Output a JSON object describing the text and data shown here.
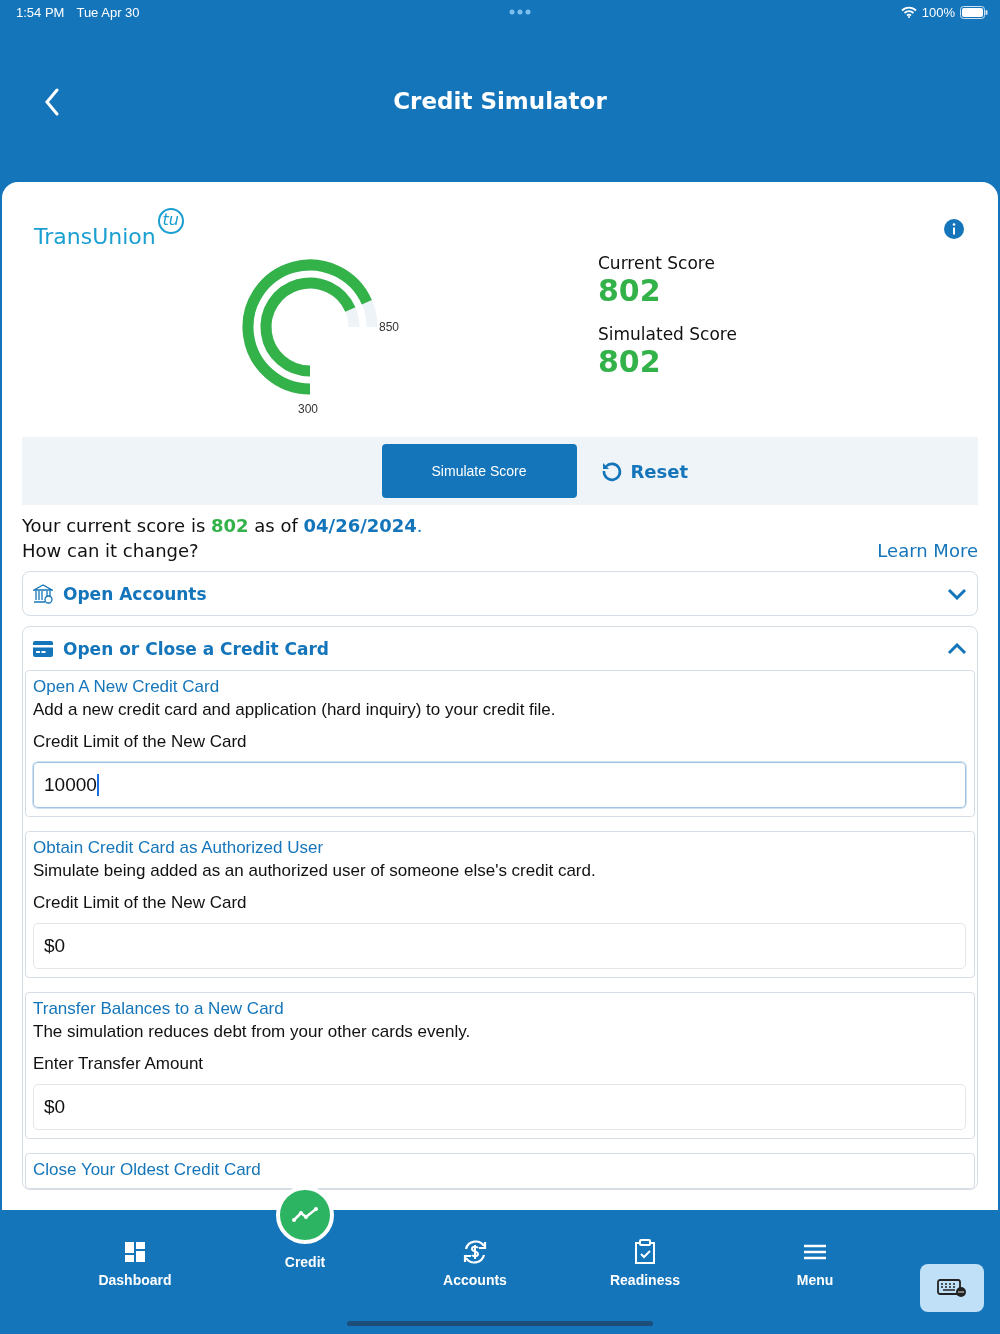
{
  "status_bar": {
    "time": "1:54 PM",
    "date": "Tue Apr 30",
    "battery": "100%"
  },
  "header": {
    "title": "Credit Simulator"
  },
  "logo": {
    "text": "TransUnion",
    "mark": "tu"
  },
  "gauge": {
    "min_label": "300",
    "max_label": "850",
    "arcs": [
      {
        "level": 0.913
      },
      {
        "level": 0.913
      }
    ]
  },
  "scores": [
    {
      "label": "Current Score",
      "value": "802"
    },
    {
      "label": "Simulated Score",
      "value": "802"
    }
  ],
  "actions": {
    "simulate": "Simulate Score",
    "reset": "Reset"
  },
  "summary": {
    "prefix": "Your current score is",
    "score": "802",
    "middle": "as of",
    "date": "04/26/2024",
    "suffix": "."
  },
  "prompt": "How can it change?",
  "learn_more": "Learn More",
  "sections": [
    {
      "title": "Open Accounts",
      "expanded": false
    },
    {
      "title": "Open or Close a Credit Card",
      "expanded": true,
      "options": [
        {
          "title": "Open A New Credit Card",
          "description": "Add a new credit card and application (hard inquiry) to your credit file.",
          "field_label": "Credit Limit of the New Card",
          "value": "10000",
          "focused": true
        },
        {
          "title": "Obtain Credit Card as Authorized User",
          "description": "Simulate being added as an authorized user of someone else's credit card.",
          "field_label": "Credit Limit of the New Card",
          "value": "$0",
          "focused": false
        },
        {
          "title": "Transfer Balances to a New Card",
          "description": "The simulation reduces debt from your other cards evenly.",
          "field_label": "Enter Transfer Amount",
          "value": "$0",
          "focused": false
        },
        {
          "title": "Close Your Oldest Credit Card"
        }
      ]
    }
  ],
  "nav": [
    {
      "label": "Dashboard",
      "selected": false
    },
    {
      "label": "Credit",
      "selected": true
    },
    {
      "label": "Accounts",
      "selected": false
    },
    {
      "label": "Readiness",
      "selected": false
    },
    {
      "label": "Menu",
      "selected": false
    }
  ]
}
